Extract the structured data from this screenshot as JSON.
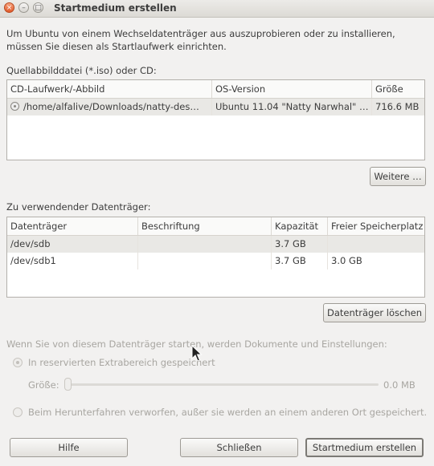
{
  "window": {
    "title": "Startmedium erstellen",
    "close": "×",
    "minimize": "–",
    "maximize": "□"
  },
  "intro": "Um Ubuntu von einem Wechseldatenträger aus auszuprobieren oder zu installieren, müssen Sie diesen als Startlaufwerk einrichten.",
  "source": {
    "label": "Quellabbilddatei (*.iso) oder CD:",
    "columns": [
      "CD-Laufwerk/-Abbild",
      "OS-Version",
      "Größe"
    ],
    "rows": [
      {
        "path": "/home/alfalive/Downloads/natty-des…",
        "os": "Ubuntu 11.04 \"Natty Narwhal\" …",
        "size": "716.6 MB"
      }
    ],
    "more_button": "Weitere …"
  },
  "target": {
    "label": "Zu verwendender Datenträger:",
    "columns": [
      "Datenträger",
      "Beschriftung",
      "Kapazität",
      "Freier Speicherplatz"
    ],
    "rows": [
      {
        "device": "/dev/sdb",
        "label": "",
        "capacity": "3.7 GB",
        "free": ""
      },
      {
        "device": "/dev/sdb1",
        "label": "",
        "capacity": "3.7 GB",
        "free": "3.0 GB"
      }
    ],
    "erase_button": "Datenträger löschen"
  },
  "options": {
    "heading": "Wenn Sie von diesem Datenträger starten, werden Dokumente und Einstellungen:",
    "radio_reserved": "In reservierten Extrabereich gespeichert",
    "size_label": "Größe:",
    "size_value": "0.0 MB",
    "radio_discard": "Beim Herunterfahren verworfen, außer sie werden an einem anderen Ort gespeichert."
  },
  "buttons": {
    "help": "Hilfe",
    "close": "Schließen",
    "create": "Startmedium erstellen"
  }
}
